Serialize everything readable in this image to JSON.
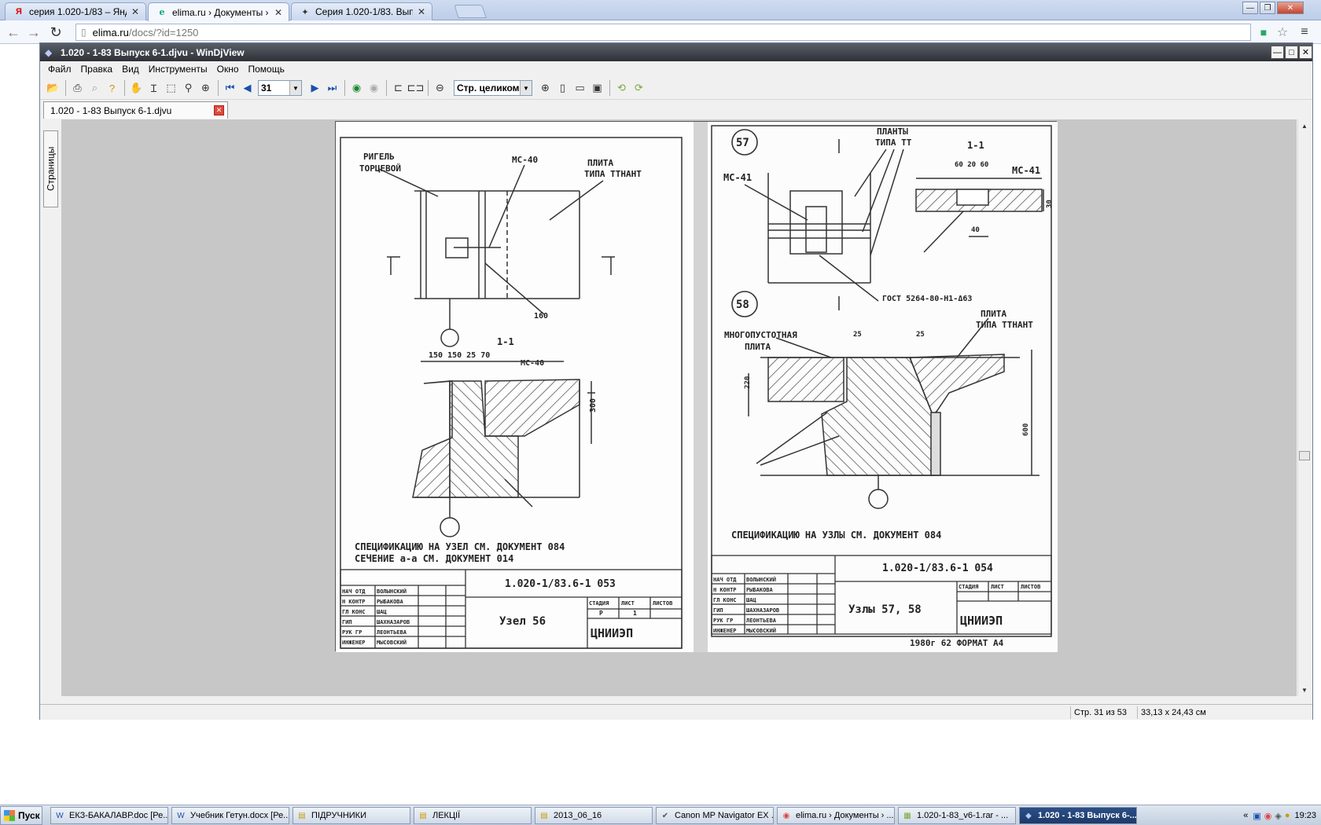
{
  "browser": {
    "tabs": [
      {
        "title": "серия 1.020-1/83 – Яндекс",
        "favicon": "Я"
      },
      {
        "title": "elima.ru › Документы › Сер",
        "favicon": "e"
      },
      {
        "title": "Серия 1.020-1/83. Выпуск",
        "favicon": "✦"
      }
    ],
    "address_host": "elima.ru",
    "address_path": "/docs/?id=1250"
  },
  "djv": {
    "title": "1.020 - 1-83 Выпуск 6-1.djvu - WinDjView",
    "menu": [
      "Файл",
      "Правка",
      "Вид",
      "Инструменты",
      "Окно",
      "Помощь"
    ],
    "page_number": "31",
    "zoom": "Стр. целиком",
    "doc_tab": "1.020 - 1-83 Выпуск 6-1.djvu",
    "sidebar_label": "Страницы",
    "status_page": "Стр. 31 из 53",
    "status_size": "33,13 x 24,43 см"
  },
  "scan": {
    "left": {
      "label_rigel": "РИГЕЛЬ",
      "label_torcevoy": "ТОРЦЕВОЙ",
      "label_mc40": "МС-40",
      "label_plita": "ПЛИТА",
      "label_plita_type": "ТИПА ТТНАНТ",
      "section": "1-1",
      "dims": "150 150 25 70",
      "dim_160": "160",
      "dim_300": "300",
      "spec_line1": "СПЕЦИФИКАЦИЮ НА УЗЕЛ СМ. ДОКУМЕНТ 084",
      "spec_line2": "СЕЧЕНИЕ а-а СМ. ДОКУМЕНТ 014",
      "code": "1.020-1/83.6-1 053",
      "node_title": "Узел 56",
      "org": "ЦНИИЭП",
      "sig_rows": [
        [
          "НАЧ ОТД",
          "ВОЛЫНСКИЙ"
        ],
        [
          "Н КОНТР",
          "РЫБАКОВА"
        ],
        [
          "ГЛ КОНС",
          "ШАЦ"
        ],
        [
          "ГИП",
          "ШАХНАЗАРОВ"
        ],
        [
          "РУК ГР",
          "ЛЕОНТЬЕВА"
        ],
        [
          "ИНЖЕНЕР",
          "МЫСОВСКИЙ"
        ]
      ],
      "stage_headers": [
        "СТАДИЯ",
        "ЛИСТ",
        "ЛИСТОВ"
      ],
      "stage_values": [
        "Р",
        "1",
        ""
      ]
    },
    "right": {
      "node57": "57",
      "node58": "58",
      "label_mc41": "МС-41",
      "label_planty": "ПЛАНТЫ",
      "label_tipa_tt": "ТИПА ТТ",
      "section": "1-1",
      "dims_top": "60 20 60",
      "dim_40": "40",
      "dim_30": "30",
      "gost": "ГОСТ 5264-80-Н1-Δ63",
      "label_mnogopust": "МНОГОПУСТОТНАЯ",
      "label_plita": "ПЛИТА",
      "label_plita_type": "ТИПА ТТНАНТ",
      "dim_25a": "25",
      "dim_25b": "25",
      "dim_220": "220",
      "dim_600": "600",
      "spec_line": "СПЕЦИФИКАЦИЮ НА УЗЛЫ СМ. ДОКУМЕНТ 084",
      "code": "1.020-1/83.6-1 054",
      "node_title": "Узлы 57, 58",
      "org": "ЦНИИЭП",
      "footer": "1980г 62 ФОРМАТ А4"
    }
  },
  "taskbar": {
    "start": "Пуск",
    "tasks": [
      {
        "label": "ЕКЗ-БАКАЛАВР.doc [Ре...",
        "icon": "W"
      },
      {
        "label": "Учебник Гетун.docx [Ре...",
        "icon": "W"
      },
      {
        "label": "ПІДРУЧНИКИ",
        "icon": "▤"
      },
      {
        "label": "ЛЕКЦІЇ",
        "icon": "▤"
      },
      {
        "label": "2013_06_16",
        "icon": "▤"
      },
      {
        "label": "Canon MP Navigator EX ...",
        "icon": "✔"
      },
      {
        "label": "elima.ru › Документы › ...",
        "icon": "◉"
      },
      {
        "label": "1.020-1-83_v6-1.rar - ...",
        "icon": "▦"
      },
      {
        "label": "1.020 - 1-83 Выпуск 6-...",
        "icon": "◆"
      }
    ],
    "clock": "19:23"
  }
}
